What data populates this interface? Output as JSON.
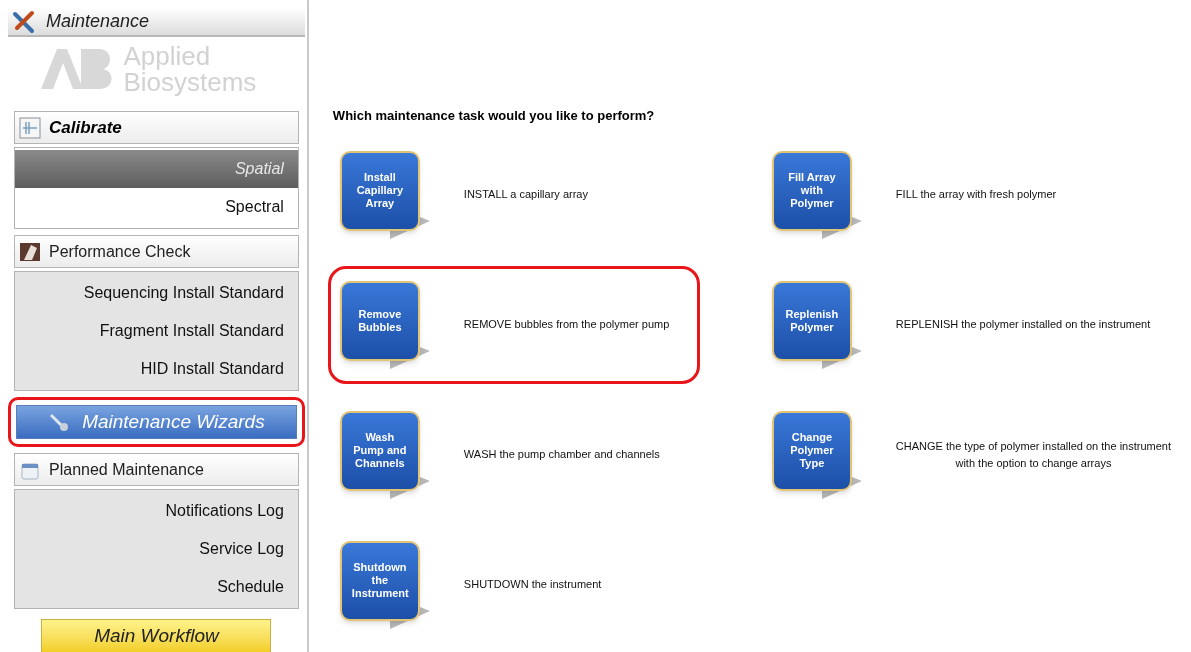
{
  "sidebar": {
    "title": "Maintenance",
    "logo": "Applied Biosystems",
    "sections": [
      {
        "kind": "group",
        "title": "Calibrate",
        "active": true,
        "items": [
          {
            "label": "Spatial",
            "selected": true
          },
          {
            "label": "Spectral",
            "selected": false
          }
        ]
      },
      {
        "kind": "group",
        "title": "Performance Check",
        "active": false,
        "items": [
          {
            "label": "Sequencing Install Standard",
            "selected": false
          },
          {
            "label": "Fragment Install Standard",
            "selected": false
          },
          {
            "label": "HID Install Standard",
            "selected": false
          }
        ]
      },
      {
        "kind": "bar",
        "title": "Maintenance Wizards",
        "selected": true,
        "highlighted": true
      },
      {
        "kind": "group",
        "title": "Planned Maintenance",
        "active": false,
        "items": [
          {
            "label": "Notifications Log",
            "selected": false
          },
          {
            "label": "Service Log",
            "selected": false
          },
          {
            "label": "Schedule",
            "selected": false
          }
        ]
      }
    ],
    "footer_button": "Main Workflow"
  },
  "main": {
    "question": "Which maintenance task would you like to perform?",
    "tasks": [
      {
        "label": "Install Capillary Array",
        "description": "INSTALL a capillary array",
        "highlighted": false
      },
      {
        "label": "Fill Array with Polymer",
        "description": "FILL the array with fresh polymer",
        "highlighted": false
      },
      {
        "label": "Remove Bubbles",
        "description": "REMOVE bubbles from the polymer pump",
        "highlighted": true
      },
      {
        "label": "Replenish Polymer",
        "description": "REPLENISH the polymer installed on the instrument",
        "highlighted": false
      },
      {
        "label": "Wash Pump and Channels",
        "description": "WASH the pump chamber and channels",
        "highlighted": false
      },
      {
        "label": "Change Polymer Type",
        "description": "CHANGE the type of polymer installed on the instrument\nwith the option to change arrays",
        "highlighted": false
      },
      {
        "label": "Shutdown the Instrument",
        "description": "SHUTDOWN the instrument",
        "highlighted": false
      }
    ]
  }
}
